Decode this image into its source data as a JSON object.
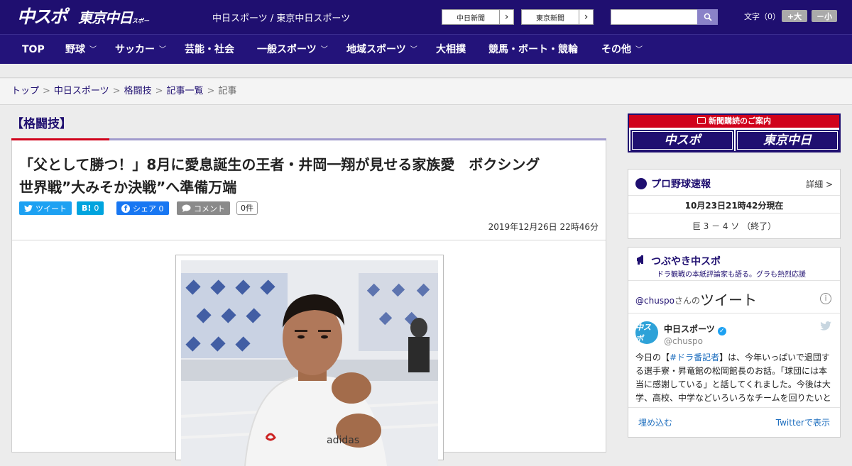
{
  "header": {
    "logo_main": "中スポ",
    "logo_tokyo": "東京中日",
    "logo_tokyo_suffix": "スポーツ",
    "site_links": "中日スポーツ / 東京中日スポーツ",
    "paper1": "中日新聞",
    "paper2": "東京新聞",
    "search_placeholder": "",
    "font_label": "文字（0）",
    "font_larger": "+大",
    "font_smaller": "－小"
  },
  "nav": [
    {
      "label": "TOP",
      "has_menu": false
    },
    {
      "label": "野球",
      "has_menu": true
    },
    {
      "label": "サッカー",
      "has_menu": true
    },
    {
      "label": "芸能・社会",
      "has_menu": false
    },
    {
      "label": "一般スポーツ",
      "has_menu": true
    },
    {
      "label": "地域スポーツ",
      "has_menu": true
    },
    {
      "label": "大相撲",
      "has_menu": false
    },
    {
      "label": "競馬・ボート・競輪",
      "has_menu": false
    },
    {
      "label": "その他",
      "has_menu": true
    }
  ],
  "breadcrumb": {
    "items": [
      "トップ",
      "中日スポーツ",
      "格闘技",
      "記事一覧"
    ],
    "current": "記事",
    "sep": ">"
  },
  "article": {
    "category": "【格闘技】",
    "title_line1": "「父として勝つ！」8月に愛息誕生の王者・井岡一翔が見せる家族愛　ボクシング",
    "title_line2": "世界戦”大みそか決戦”へ準備万端",
    "share": {
      "tweet": "ツイート",
      "hatena_icon": "B!",
      "hatena_count": "0",
      "facebook": "シェア 0",
      "comment": "コメント",
      "comment_count": "0件"
    },
    "date": "2019年12月26日 22時46分"
  },
  "sidebar": {
    "ad_title": "新聞購読のご案内",
    "ad_left": "中スポ",
    "ad_right": "東京中日",
    "baseball": {
      "title": "プロ野球速報",
      "detail": "詳細 >",
      "timestamp": "10月23日21時42分現在",
      "score": "巨 3 － 4 ソ （終了）"
    },
    "tsubuyaki": {
      "title": "つぶやき中スポ",
      "subtitle": "ドラ観戦の本紙評論家も語る。グラも熱烈応援",
      "handle_head": "@chuspo",
      "san_no": "さんの",
      "tweet_word": "ツイート",
      "info": "i",
      "avatar": "中スポ",
      "name": "中日スポーツ",
      "handle": "@chuspo",
      "text_pre": "今日の【",
      "hashtag": "#ドラ番記者",
      "text_post": "】は、今年いっぱいで退団する選手寮・昇竜館の松岡館長のお話。「球団には本当に感謝している」と話してくれました。今後は大学、高校、中学などいろいろなチームを回りたいと",
      "embed": "埋め込む",
      "view": "Twitterで表示"
    }
  },
  "colors": {
    "brand": "#1f0f70",
    "accent_red": "#d0021b",
    "twitter": "#1da1f2",
    "facebook": "#1877f2",
    "hatena": "#00a4de"
  }
}
